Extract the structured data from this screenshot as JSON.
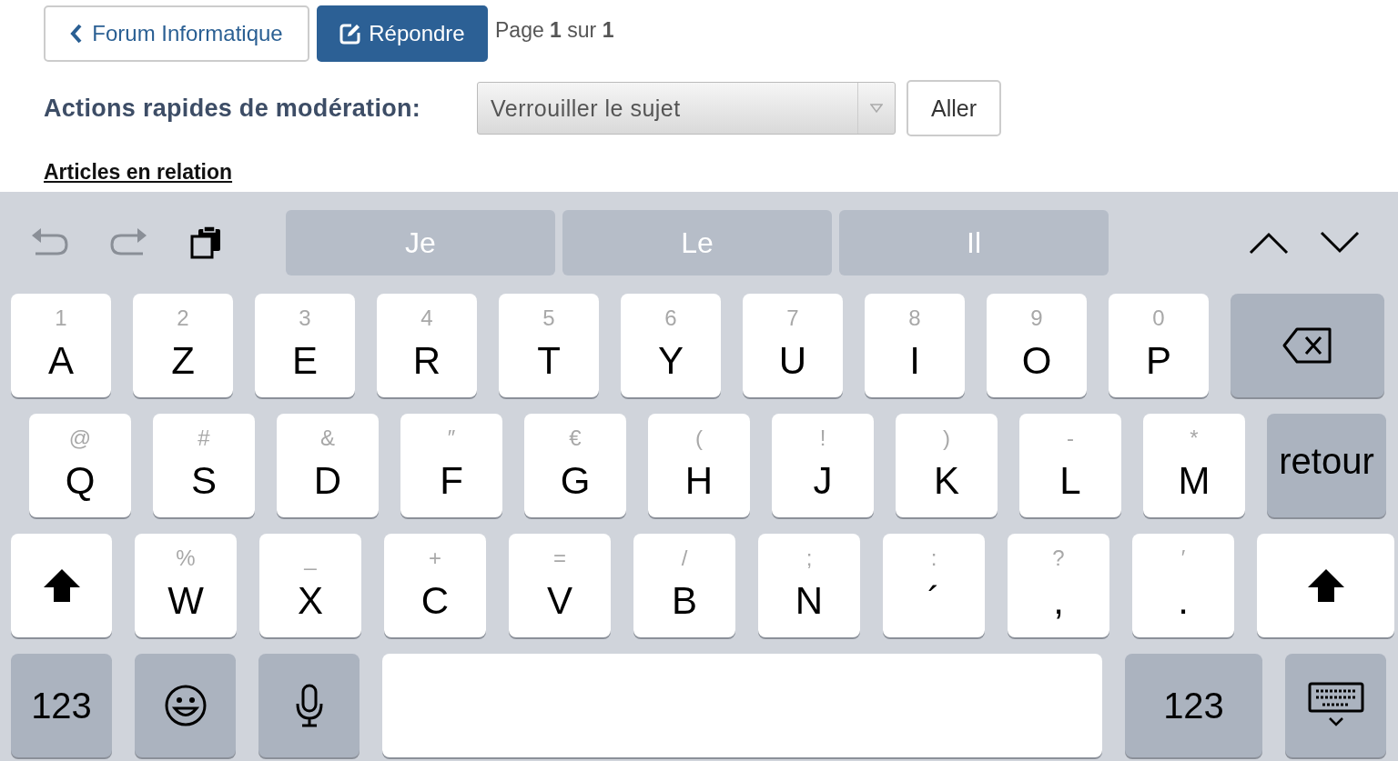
{
  "nav": {
    "back_button": "Forum Informatique",
    "reply_button": "Répondre",
    "pagination": "Page **1** sur **1**"
  },
  "moderation": {
    "label": "Actions rapides de modération:",
    "select": {
      "value": "Verrouiller le sujet"
    },
    "go_button": "Aller"
  },
  "related_link": "Articles en relation",
  "keyboard": {
    "suggestions": [
      "Je",
      "Le",
      "Il"
    ],
    "rows": [
      [
        {
          "kind": "letter",
          "hint": "1",
          "label": "A"
        },
        {
          "kind": "letter",
          "hint": "2",
          "label": "Z"
        },
        {
          "kind": "letter",
          "hint": "3",
          "label": "E"
        },
        {
          "kind": "letter",
          "hint": "4",
          "label": "R"
        },
        {
          "kind": "letter",
          "hint": "5",
          "label": "T"
        },
        {
          "kind": "letter",
          "hint": "6",
          "label": "Y"
        },
        {
          "kind": "letter",
          "hint": "7",
          "label": "U"
        },
        {
          "kind": "letter",
          "hint": "8",
          "label": "I"
        },
        {
          "kind": "letter",
          "hint": "9",
          "label": "O"
        },
        {
          "kind": "letter",
          "hint": "0",
          "label": "P"
        },
        {
          "kind": "backspace"
        }
      ],
      [
        {
          "kind": "letter",
          "hint": "@",
          "label": "Q"
        },
        {
          "kind": "letter",
          "hint": "#",
          "label": "S"
        },
        {
          "kind": "letter",
          "hint": "&",
          "label": "D"
        },
        {
          "kind": "letter",
          "hint": "″",
          "label": "F"
        },
        {
          "kind": "letter",
          "hint": "€",
          "label": "G"
        },
        {
          "kind": "letter",
          "hint": "(",
          "label": "H"
        },
        {
          "kind": "letter",
          "hint": "!",
          "label": "J"
        },
        {
          "kind": "letter",
          "hint": ")",
          "label": "K"
        },
        {
          "kind": "letter",
          "hint": "-",
          "label": "L"
        },
        {
          "kind": "letter",
          "hint": "*",
          "label": "M"
        },
        {
          "kind": "return",
          "label": "retour"
        }
      ],
      [
        {
          "kind": "shift"
        },
        {
          "kind": "letter",
          "hint": "%",
          "label": "W"
        },
        {
          "kind": "letter",
          "hint": "_",
          "label": "X"
        },
        {
          "kind": "letter",
          "hint": "+",
          "label": "C"
        },
        {
          "kind": "letter",
          "hint": "=",
          "label": "V"
        },
        {
          "kind": "letter",
          "hint": "/",
          "label": "B"
        },
        {
          "kind": "letter",
          "hint": ";",
          "label": "N"
        },
        {
          "kind": "punct",
          "hint": ":",
          "label": "´"
        },
        {
          "kind": "punct",
          "hint": "?",
          "label": ","
        },
        {
          "kind": "punct",
          "hint": "′",
          "label": "."
        },
        {
          "kind": "shift"
        }
      ]
    ],
    "bottom_bar": {
      "left_numbers_key": "123",
      "right_numbers_key": "123"
    }
  }
}
